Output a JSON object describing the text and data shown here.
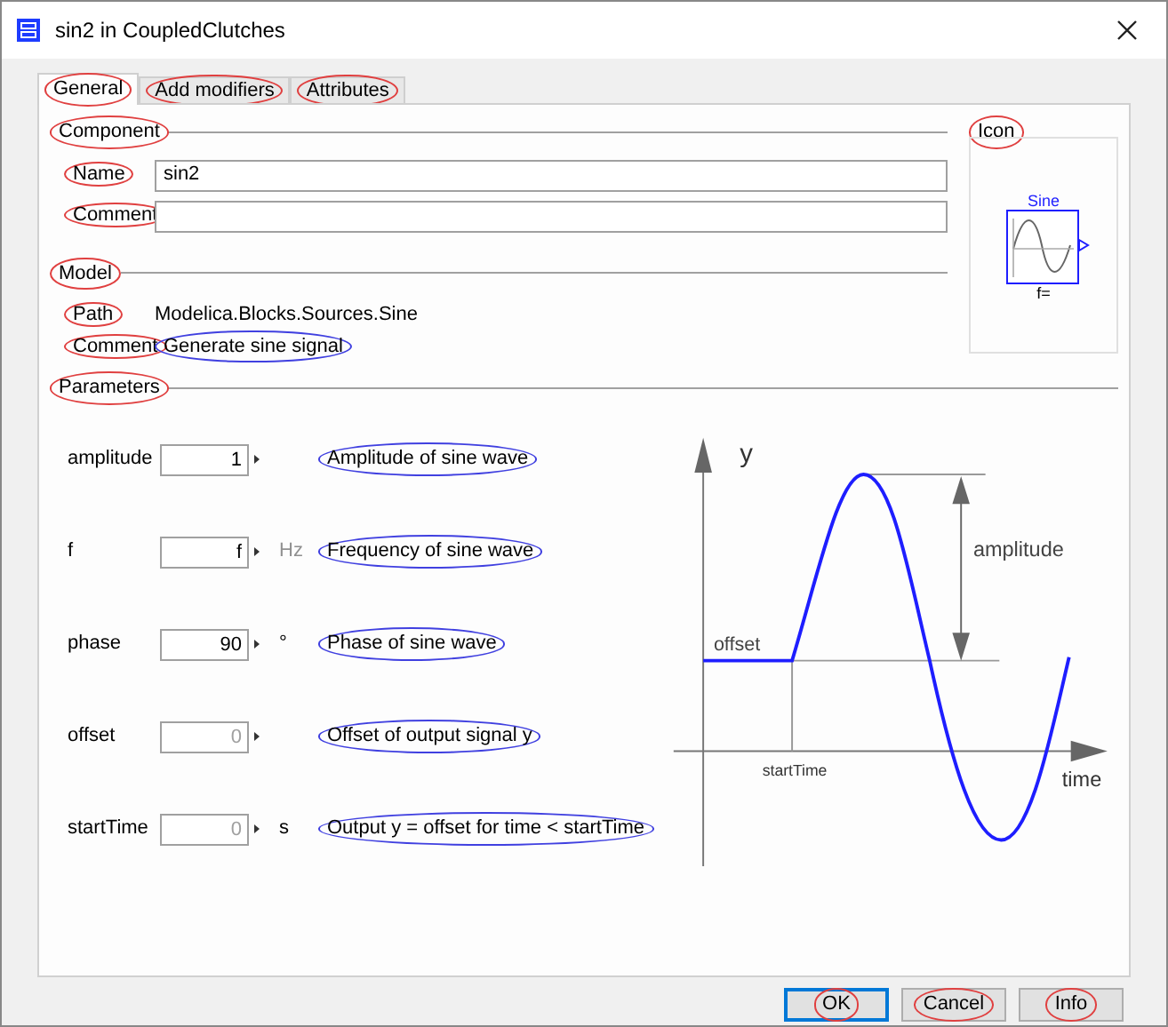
{
  "window": {
    "title": "sin2 in CoupledClutches"
  },
  "tabs": [
    {
      "label": "General",
      "selected": true
    },
    {
      "label": "Add modifiers",
      "selected": false
    },
    {
      "label": "Attributes",
      "selected": false
    }
  ],
  "component": {
    "legend": "Component",
    "name_label": "Name",
    "name_value": "sin2",
    "comment_label": "Comment"
  },
  "icon": {
    "legend": "Icon",
    "block_label": "Sine",
    "parameter_text": "f="
  },
  "model": {
    "legend": "Model",
    "path_label": "Path",
    "path": "Modelica.Blocks.Sources.Sine",
    "comment_label": "Comment",
    "comment": "Generate sine signal"
  },
  "parameters": {
    "legend": "Parameters",
    "rows": [
      {
        "name": "amplitude",
        "value": "1",
        "description": "Amplitude of sine wave"
      },
      {
        "name": "f",
        "value": "f",
        "unit": "Hz",
        "description": "Frequency of sine wave"
      },
      {
        "name": "phase",
        "value": "90",
        "unit": "°",
        "description": "Phase of sine wave"
      },
      {
        "name": "offset",
        "placeholder": "0",
        "description": "Offset of output signal y"
      },
      {
        "name": "startTime",
        "placeholder": "0",
        "unit": "s",
        "description": "Output y = offset for time < startTime"
      }
    ]
  },
  "diagram": {
    "labels": [
      "y",
      "amplitude",
      "offset",
      "startTime",
      "time"
    ]
  },
  "buttons": [
    {
      "label": "OK",
      "default": true
    },
    {
      "label": "Cancel",
      "default": false
    },
    {
      "label": "Info",
      "default": false
    }
  ]
}
